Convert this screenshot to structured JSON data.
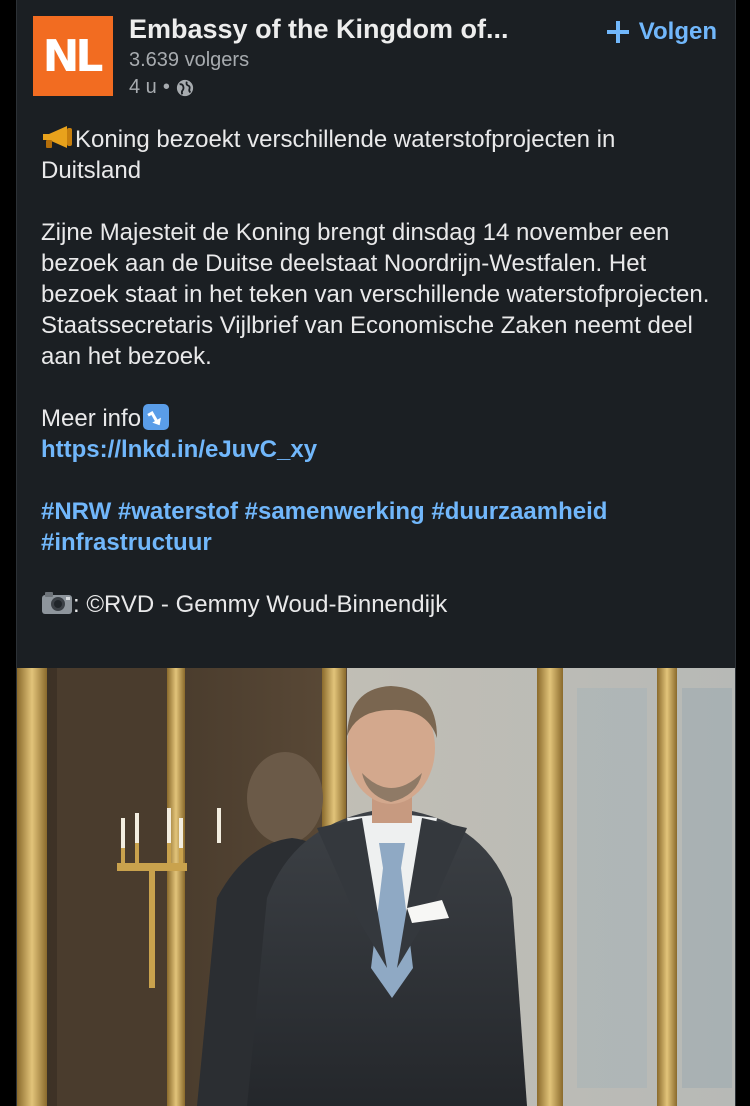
{
  "post": {
    "org_name": "Embassy of the Kingdom of...",
    "logo_text": "NL",
    "followers": "3.639 volgers",
    "time": "4 u",
    "separator": "•",
    "follow_label": "Volgen",
    "headline": "Koning bezoekt verschillende waterstofprojecten in Duitsland",
    "paragraph": "Zijne Majesteit de Koning brengt dinsdag 14 november een bezoek aan de Duitse deelstaat Noordrijn-Westfalen. Het bezoek staat in het teken van verschillende waterstofprojecten. Staatssecretaris Vijlbrief van Economische Zaken neemt deel aan het bezoek.",
    "more_info": "Meer info",
    "link": "https://lnkd.in/eJuvC_xy",
    "hashtags": [
      "#NRW",
      "#waterstof",
      "#samenwerking",
      "#duurzaamheid",
      "#infrastructuur"
    ],
    "photo_credit": ": ©RVD - Gemmy Woud-Binnendijk"
  },
  "icons": {
    "headline_emoji": "megaphone-icon",
    "more_info_emoji": "arrow-down-right-icon",
    "credit_emoji": "camera-icon",
    "visibility": "globe-icon",
    "follow": "plus-icon"
  },
  "colors": {
    "background": "#000000",
    "card": "#1b1f23",
    "accent_link": "#71b7fb",
    "brand_orange": "#f26c21",
    "secondary_text": "#a7abaf"
  }
}
